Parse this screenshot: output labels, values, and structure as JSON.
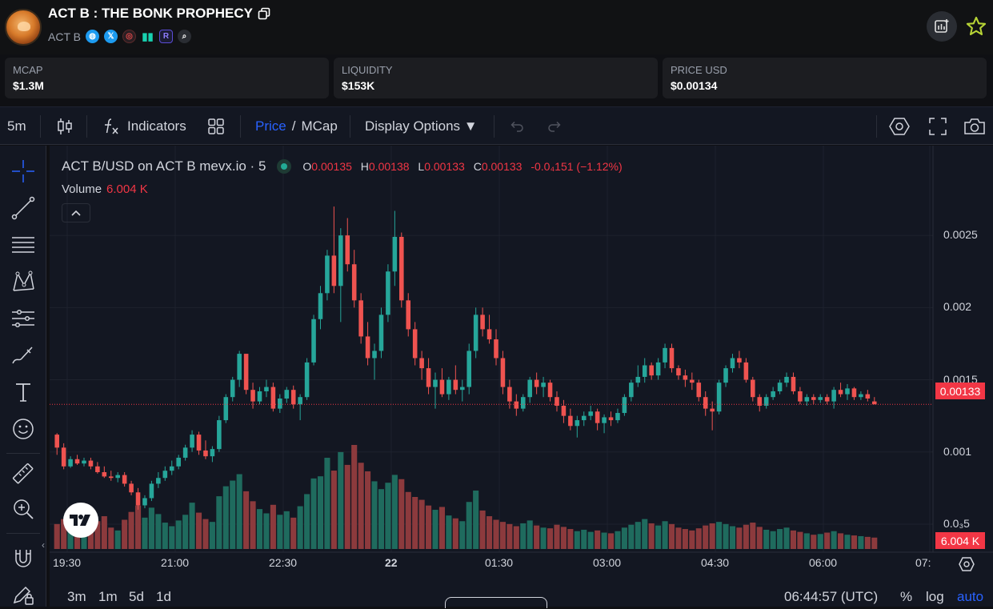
{
  "header": {
    "title": "ACT B : THE BONK PROPHECY",
    "ticker": "ACT B"
  },
  "stats": [
    {
      "label": "MCAP",
      "value": "$1.3M"
    },
    {
      "label": "LIQUIDITY",
      "value": "$153K"
    },
    {
      "label": "PRICE USD",
      "value": "$0.00134"
    }
  ],
  "toolbar": {
    "interval": "5m",
    "indicators_label": "Indicators",
    "price_label": "Price",
    "slash": "/",
    "mcap_label": "MCap",
    "display_options_label": "Display Options ▼"
  },
  "legend": {
    "symbol": "ACT B/USD on ACT B mevx.io · 5",
    "o_key": "O",
    "o_val": "0.00135",
    "h_key": "H",
    "h_val": "0.00138",
    "l_key": "L",
    "l_val": "0.00133",
    "c_key": "C",
    "c_val": "0.00133",
    "change": "-0.0₄151 (−1.12%)",
    "volume_label": "Volume",
    "volume_value": "6.004 K"
  },
  "price_axis": {
    "ticks": [
      "0.0025",
      "0.002",
      "0.0015",
      "0.001",
      "0.0₃5"
    ],
    "current_price": "0.00133",
    "current_volume": "6.004 K"
  },
  "time_axis": {
    "ticks": [
      "19:30",
      "21:00",
      "22:30",
      "22",
      "01:30",
      "03:00",
      "04:30",
      "06:00",
      "07:"
    ]
  },
  "bottom": {
    "ranges": [
      "3m",
      "1m",
      "5d",
      "1d"
    ],
    "clock": "06:44:57 (UTC)",
    "percent": "%",
    "log": "log",
    "auto": "auto"
  },
  "colors": {
    "up": "#26a69a",
    "down": "#ef5350",
    "accent": "#2962ff",
    "background": "#131722"
  },
  "chart_data": {
    "type": "candlestick",
    "interval": "5",
    "y_ticks": [
      "0.0025",
      "0.002",
      "0.0015",
      "0.001",
      "0.0₃5"
    ],
    "x_ticks": [
      "19:30",
      "21:00",
      "22:30",
      "22",
      "01:30",
      "03:00",
      "04:30",
      "06:00",
      "07:"
    ],
    "last_price": 0.00133,
    "ylim": [
      0.00035,
      0.0029
    ],
    "candles": [
      [
        0.00112,
        0.00113,
        0.00098,
        0.00103,
        3.5
      ],
      [
        0.00103,
        0.00106,
        0.00088,
        0.0009,
        4.2
      ],
      [
        0.0009,
        0.00097,
        0.00089,
        0.00095,
        5.0
      ],
      [
        0.00095,
        0.00098,
        0.00091,
        0.00092,
        3.1
      ],
      [
        0.00092,
        0.00096,
        0.0009,
        0.00094,
        2.8
      ],
      [
        0.00094,
        0.00096,
        0.00088,
        0.0009,
        3.3
      ],
      [
        0.0009,
        0.00093,
        0.00085,
        0.00086,
        3.9
      ],
      [
        0.00086,
        0.0009,
        0.00082,
        0.00083,
        4.6
      ],
      [
        0.00083,
        0.00087,
        0.0008,
        0.00082,
        3.0
      ],
      [
        0.00082,
        0.00086,
        0.00079,
        0.00084,
        2.6
      ],
      [
        0.00084,
        0.00086,
        0.00076,
        0.00078,
        4.1
      ],
      [
        0.00078,
        0.0008,
        0.0007,
        0.00072,
        5.2
      ],
      [
        0.00072,
        0.00075,
        0.0006,
        0.00063,
        6.1
      ],
      [
        0.00063,
        0.0007,
        0.00061,
        0.00068,
        4.4
      ],
      [
        0.00068,
        0.0008,
        0.00066,
        0.00078,
        5.8
      ],
      [
        0.00078,
        0.00086,
        0.00075,
        0.00082,
        4.9
      ],
      [
        0.00082,
        0.0009,
        0.0008,
        0.00087,
        3.7
      ],
      [
        0.00087,
        0.00094,
        0.00084,
        0.0009,
        3.2
      ],
      [
        0.0009,
        0.00098,
        0.00088,
        0.00096,
        4.0
      ],
      [
        0.00096,
        0.00105,
        0.00094,
        0.00103,
        4.8
      ],
      [
        0.00103,
        0.00115,
        0.001,
        0.00112,
        6.5
      ],
      [
        0.00112,
        0.00114,
        0.00098,
        0.00101,
        5.1
      ],
      [
        0.00101,
        0.00108,
        0.00095,
        0.00097,
        4.2
      ],
      [
        0.00097,
        0.00104,
        0.00093,
        0.00102,
        3.8
      ],
      [
        0.00102,
        0.00125,
        0.001,
        0.00122,
        7.4
      ],
      [
        0.00122,
        0.0014,
        0.0012,
        0.00138,
        8.8
      ],
      [
        0.00138,
        0.00152,
        0.00135,
        0.0015,
        9.6
      ],
      [
        0.0015,
        0.0017,
        0.00145,
        0.00168,
        10.5
      ],
      [
        0.00168,
        0.00165,
        0.0014,
        0.00143,
        8.1
      ],
      [
        0.00143,
        0.00148,
        0.0013,
        0.00135,
        6.7
      ],
      [
        0.00135,
        0.00145,
        0.00133,
        0.00142,
        5.6
      ],
      [
        0.00142,
        0.0015,
        0.00138,
        0.00145,
        5.0
      ],
      [
        0.00145,
        0.00148,
        0.00128,
        0.0013,
        6.2
      ],
      [
        0.0013,
        0.0014,
        0.00127,
        0.00137,
        4.8
      ],
      [
        0.00137,
        0.00145,
        0.00134,
        0.00143,
        5.3
      ],
      [
        0.00143,
        0.00146,
        0.0013,
        0.00133,
        4.4
      ],
      [
        0.00133,
        0.0014,
        0.00122,
        0.00138,
        6.0
      ],
      [
        0.00138,
        0.00165,
        0.00136,
        0.00162,
        7.7
      ],
      [
        0.00162,
        0.00195,
        0.0016,
        0.00192,
        9.9
      ],
      [
        0.00192,
        0.00215,
        0.00185,
        0.0021,
        10.2
      ],
      [
        0.0021,
        0.0024,
        0.00205,
        0.00236,
        12.8
      ],
      [
        0.00236,
        0.0027,
        0.0021,
        0.00215,
        11.0
      ],
      [
        0.00215,
        0.00255,
        0.0019,
        0.0025,
        13.6
      ],
      [
        0.0025,
        0.00262,
        0.00225,
        0.0023,
        11.8
      ],
      [
        0.0023,
        0.0024,
        0.002,
        0.00205,
        14.6
      ],
      [
        0.00205,
        0.0021,
        0.00175,
        0.0018,
        12.1
      ],
      [
        0.0018,
        0.0019,
        0.0016,
        0.00165,
        10.9
      ],
      [
        0.00165,
        0.00175,
        0.0015,
        0.0017,
        9.5
      ],
      [
        0.0017,
        0.002,
        0.00165,
        0.00195,
        8.4
      ],
      [
        0.00195,
        0.0023,
        0.0019,
        0.00225,
        9.3
      ],
      [
        0.00225,
        0.00267,
        0.00215,
        0.00249,
        10.4
      ],
      [
        0.00249,
        0.00252,
        0.002,
        0.00205,
        9.8
      ],
      [
        0.00205,
        0.0021,
        0.0018,
        0.00185,
        8.0
      ],
      [
        0.00185,
        0.0019,
        0.0016,
        0.00165,
        7.3
      ],
      [
        0.00165,
        0.0017,
        0.0015,
        0.00158,
        6.9
      ],
      [
        0.00158,
        0.00165,
        0.0014,
        0.00145,
        6.1
      ],
      [
        0.00145,
        0.00155,
        0.0013,
        0.0015,
        5.5
      ],
      [
        0.0015,
        0.00158,
        0.00138,
        0.0014,
        5.9
      ],
      [
        0.0014,
        0.00152,
        0.00136,
        0.0015,
        4.7
      ],
      [
        0.0015,
        0.0016,
        0.0014,
        0.00143,
        4.3
      ],
      [
        0.00143,
        0.0015,
        0.00135,
        0.00145,
        3.9
      ],
      [
        0.00145,
        0.00175,
        0.0014,
        0.0017,
        6.6
      ],
      [
        0.0017,
        0.002,
        0.00165,
        0.00195,
        8.2
      ],
      [
        0.00195,
        0.002,
        0.0018,
        0.00185,
        5.4
      ],
      [
        0.00185,
        0.00195,
        0.00175,
        0.00178,
        4.6
      ],
      [
        0.00178,
        0.00185,
        0.0016,
        0.00165,
        4.1
      ],
      [
        0.00165,
        0.0017,
        0.0014,
        0.00145,
        3.8
      ],
      [
        0.00145,
        0.0015,
        0.0013,
        0.00135,
        3.5
      ],
      [
        0.00135,
        0.0014,
        0.00125,
        0.0013,
        3.2
      ],
      [
        0.0013,
        0.0014,
        0.00128,
        0.00138,
        3.6
      ],
      [
        0.00138,
        0.00152,
        0.00134,
        0.0015,
        4.0
      ],
      [
        0.0015,
        0.00155,
        0.0014,
        0.00145,
        3.3
      ],
      [
        0.00145,
        0.00152,
        0.00138,
        0.00148,
        3.0
      ],
      [
        0.00148,
        0.0015,
        0.00135,
        0.00138,
        2.9
      ],
      [
        0.00138,
        0.00142,
        0.00128,
        0.00132,
        3.4
      ],
      [
        0.00132,
        0.00136,
        0.0012,
        0.00125,
        3.1
      ],
      [
        0.00125,
        0.0013,
        0.00115,
        0.00118,
        2.8
      ],
      [
        0.00118,
        0.00125,
        0.0011,
        0.00122,
        2.5
      ],
      [
        0.00122,
        0.00128,
        0.00118,
        0.00125,
        2.7
      ],
      [
        0.00125,
        0.00132,
        0.00122,
        0.00128,
        2.4
      ],
      [
        0.00128,
        0.0013,
        0.00115,
        0.0012,
        2.6
      ],
      [
        0.0012,
        0.00126,
        0.00113,
        0.00124,
        2.3
      ],
      [
        0.00124,
        0.00128,
        0.00118,
        0.00122,
        2.2
      ],
      [
        0.00122,
        0.0013,
        0.0012,
        0.00127,
        2.5
      ],
      [
        0.00127,
        0.0014,
        0.00125,
        0.00138,
        3.0
      ],
      [
        0.00138,
        0.0015,
        0.00135,
        0.00148,
        3.4
      ],
      [
        0.00148,
        0.0016,
        0.00145,
        0.00152,
        3.8
      ],
      [
        0.00152,
        0.00165,
        0.00148,
        0.0016,
        4.2
      ],
      [
        0.0016,
        0.00162,
        0.0015,
        0.00153,
        3.6
      ],
      [
        0.00153,
        0.00165,
        0.0015,
        0.00162,
        3.3
      ],
      [
        0.00162,
        0.00175,
        0.00158,
        0.00172,
        3.9
      ],
      [
        0.00172,
        0.00175,
        0.00155,
        0.00158,
        3.5
      ],
      [
        0.00158,
        0.0016,
        0.0015,
        0.00153,
        3.0
      ],
      [
        0.00153,
        0.00157,
        0.00145,
        0.0015,
        2.8
      ],
      [
        0.0015,
        0.00155,
        0.00143,
        0.00148,
        2.6
      ],
      [
        0.00148,
        0.0015,
        0.00135,
        0.00138,
        2.9
      ],
      [
        0.00138,
        0.00142,
        0.00125,
        0.0013,
        3.3
      ],
      [
        0.0013,
        0.00135,
        0.00115,
        0.00128,
        3.6
      ],
      [
        0.00128,
        0.0015,
        0.00126,
        0.00148,
        3.8
      ],
      [
        0.00148,
        0.0016,
        0.00145,
        0.00158,
        3.5
      ],
      [
        0.00158,
        0.00168,
        0.00155,
        0.00165,
        3.2
      ],
      [
        0.00165,
        0.0017,
        0.00158,
        0.00162,
        3.0
      ],
      [
        0.00162,
        0.00165,
        0.00148,
        0.0015,
        3.4
      ],
      [
        0.0015,
        0.00152,
        0.00135,
        0.00138,
        3.7
      ],
      [
        0.00138,
        0.0014,
        0.00128,
        0.00132,
        3.1
      ],
      [
        0.00132,
        0.0014,
        0.0013,
        0.00138,
        2.7
      ],
      [
        0.00138,
        0.00145,
        0.00136,
        0.00142,
        2.5
      ],
      [
        0.00142,
        0.0015,
        0.0014,
        0.00148,
        2.8
      ],
      [
        0.00148,
        0.00155,
        0.00145,
        0.00152,
        3.0
      ],
      [
        0.00152,
        0.00155,
        0.0014,
        0.00142,
        2.6
      ],
      [
        0.00142,
        0.00145,
        0.00133,
        0.00135,
        2.4
      ],
      [
        0.00135,
        0.0014,
        0.00132,
        0.00138,
        2.2
      ],
      [
        0.00138,
        0.0014,
        0.00133,
        0.00136,
        2.0
      ],
      [
        0.00136,
        0.0014,
        0.00134,
        0.00138,
        2.1
      ],
      [
        0.00138,
        0.0014,
        0.00133,
        0.00135,
        2.3
      ],
      [
        0.00135,
        0.00145,
        0.0013,
        0.00143,
        2.5
      ],
      [
        0.00143,
        0.00148,
        0.00138,
        0.0014,
        2.2
      ],
      [
        0.0014,
        0.00147,
        0.00136,
        0.00144,
        2.0
      ],
      [
        0.00144,
        0.00145,
        0.00136,
        0.00138,
        1.9
      ],
      [
        0.00138,
        0.00142,
        0.00136,
        0.0014,
        1.8
      ],
      [
        0.0014,
        0.00143,
        0.00135,
        0.00137,
        1.7
      ],
      [
        0.00135,
        0.00138,
        0.00133,
        0.00133,
        1.6
      ]
    ]
  }
}
